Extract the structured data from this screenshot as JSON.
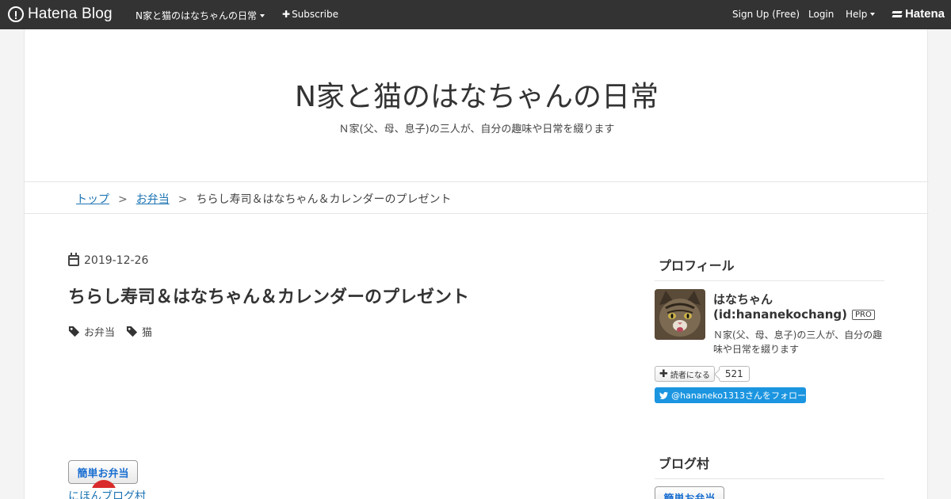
{
  "topbar": {
    "brand": "Hatena Blog",
    "blog_menu": "N家と猫のはなちゃんの日常",
    "subscribe": "Subscribe",
    "signup": "Sign Up (Free)",
    "login": "Login",
    "help": "Help",
    "hatena_logo": "Hatena"
  },
  "header": {
    "title": "N家と猫のはなちゃんの日常",
    "description": "Ｎ家(父、母、息子)の三人が、自分の趣味や日常を綴ります"
  },
  "breadcrumb": {
    "top": "トップ",
    "sep1": ">",
    "category": "お弁当",
    "sep2": ">",
    "current": "ちらし寿司＆はなちゃん＆カレンダーのプレゼント"
  },
  "entry": {
    "date": "2019-12-26",
    "title": "ちらし寿司＆はなちゃん＆カレンダーのプレゼント",
    "tags": [
      "お弁当",
      "猫"
    ],
    "banner_label": "簡単お弁当",
    "blogmura_link": "にほんブログ村"
  },
  "sidebar": {
    "profile_heading": "プロフィール",
    "name": "はなちゃん",
    "id": "(id:hananekochang)",
    "pro_badge": "PRO",
    "description": "Ｎ家(父、母、息子)の三人が、自分の趣味や日常を綴ります",
    "reader_button": "読者になる",
    "reader_count": "521",
    "twitter_follow": "@hananeko1313さんをフォロー",
    "blogmura_heading": "ブログ村",
    "banner_label": "簡単お弁当"
  },
  "colors": {
    "topbar_bg": "#333333",
    "link": "#1b73b3",
    "twitter": "#1b95e0"
  }
}
